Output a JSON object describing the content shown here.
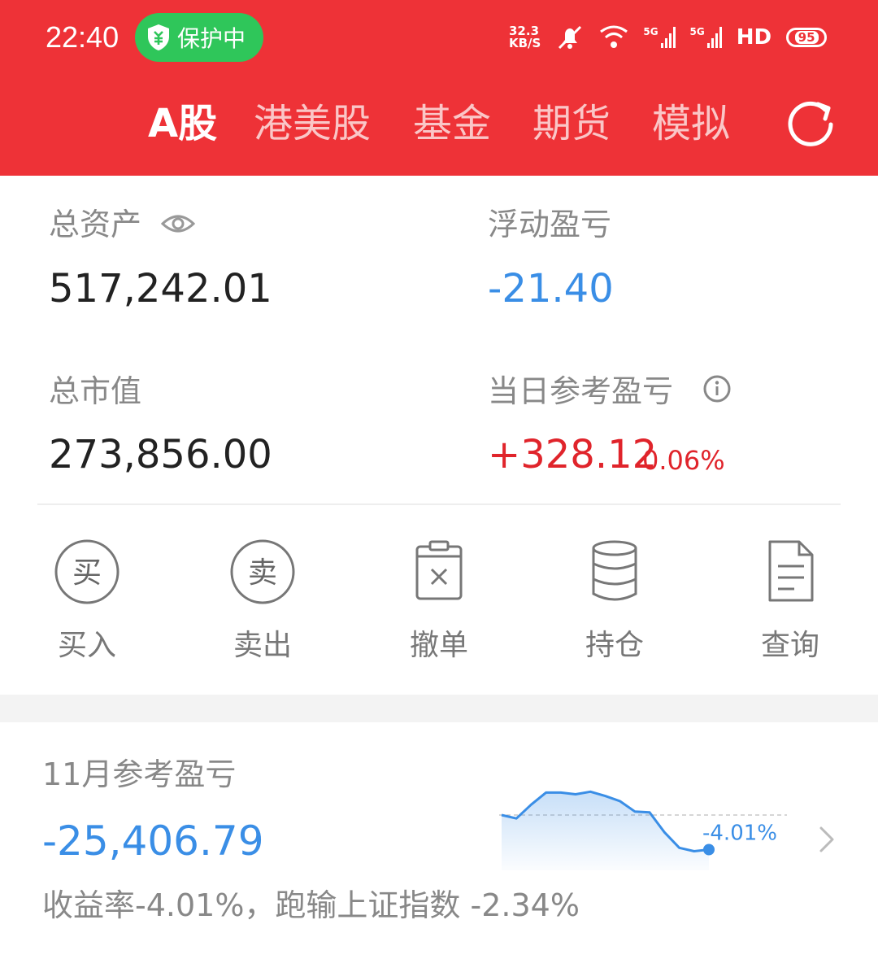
{
  "status_bar": {
    "time": "22:40",
    "protect_label": "保护中",
    "net_speed_value": "32.3",
    "net_speed_unit": "KB/S",
    "network_1": "5G",
    "network_2": "5G",
    "hd_label": "HD",
    "battery": "95"
  },
  "tabs": [
    {
      "label": "A股",
      "active": true
    },
    {
      "label": "港美股",
      "active": false
    },
    {
      "label": "基金",
      "active": false
    },
    {
      "label": "期货",
      "active": false
    },
    {
      "label": "模拟",
      "active": false
    }
  ],
  "summary": {
    "total_assets_label": "总资产",
    "total_assets_value": "517,242.01",
    "floating_pl_label": "浮动盈亏",
    "floating_pl_value": "-21.40",
    "market_value_label": "总市值",
    "market_value_value": "273,856.00",
    "daily_pl_label": "当日参考盈亏",
    "daily_pl_value": "+328.12",
    "daily_pl_pct": "0.06%"
  },
  "actions": [
    {
      "label": "买入",
      "icon": "buy-icon",
      "glyph": "买"
    },
    {
      "label": "卖出",
      "icon": "sell-icon",
      "glyph": "卖"
    },
    {
      "label": "撤单",
      "icon": "cancel-order-icon"
    },
    {
      "label": "持仓",
      "icon": "holdings-icon"
    },
    {
      "label": "查询",
      "icon": "query-icon"
    }
  ],
  "monthly": {
    "label": "11月参考盈亏",
    "value": "-25,406.79",
    "subtitle": "收益率-4.01%，跑输上证指数 -2.34%",
    "sparkline_end_label": "-4.01%",
    "sparkline_values": [
      0.0,
      -0.4,
      1.2,
      2.6,
      2.6,
      2.4,
      2.7,
      2.2,
      1.6,
      0.4,
      0.3,
      -2.0,
      -3.8,
      -4.2,
      -4.01
    ]
  },
  "colors": {
    "brand_red": "#ee3237",
    "loss_blue": "#3a8ee6",
    "gain_red": "#e0242b",
    "protect_green": "#2fc65a"
  }
}
